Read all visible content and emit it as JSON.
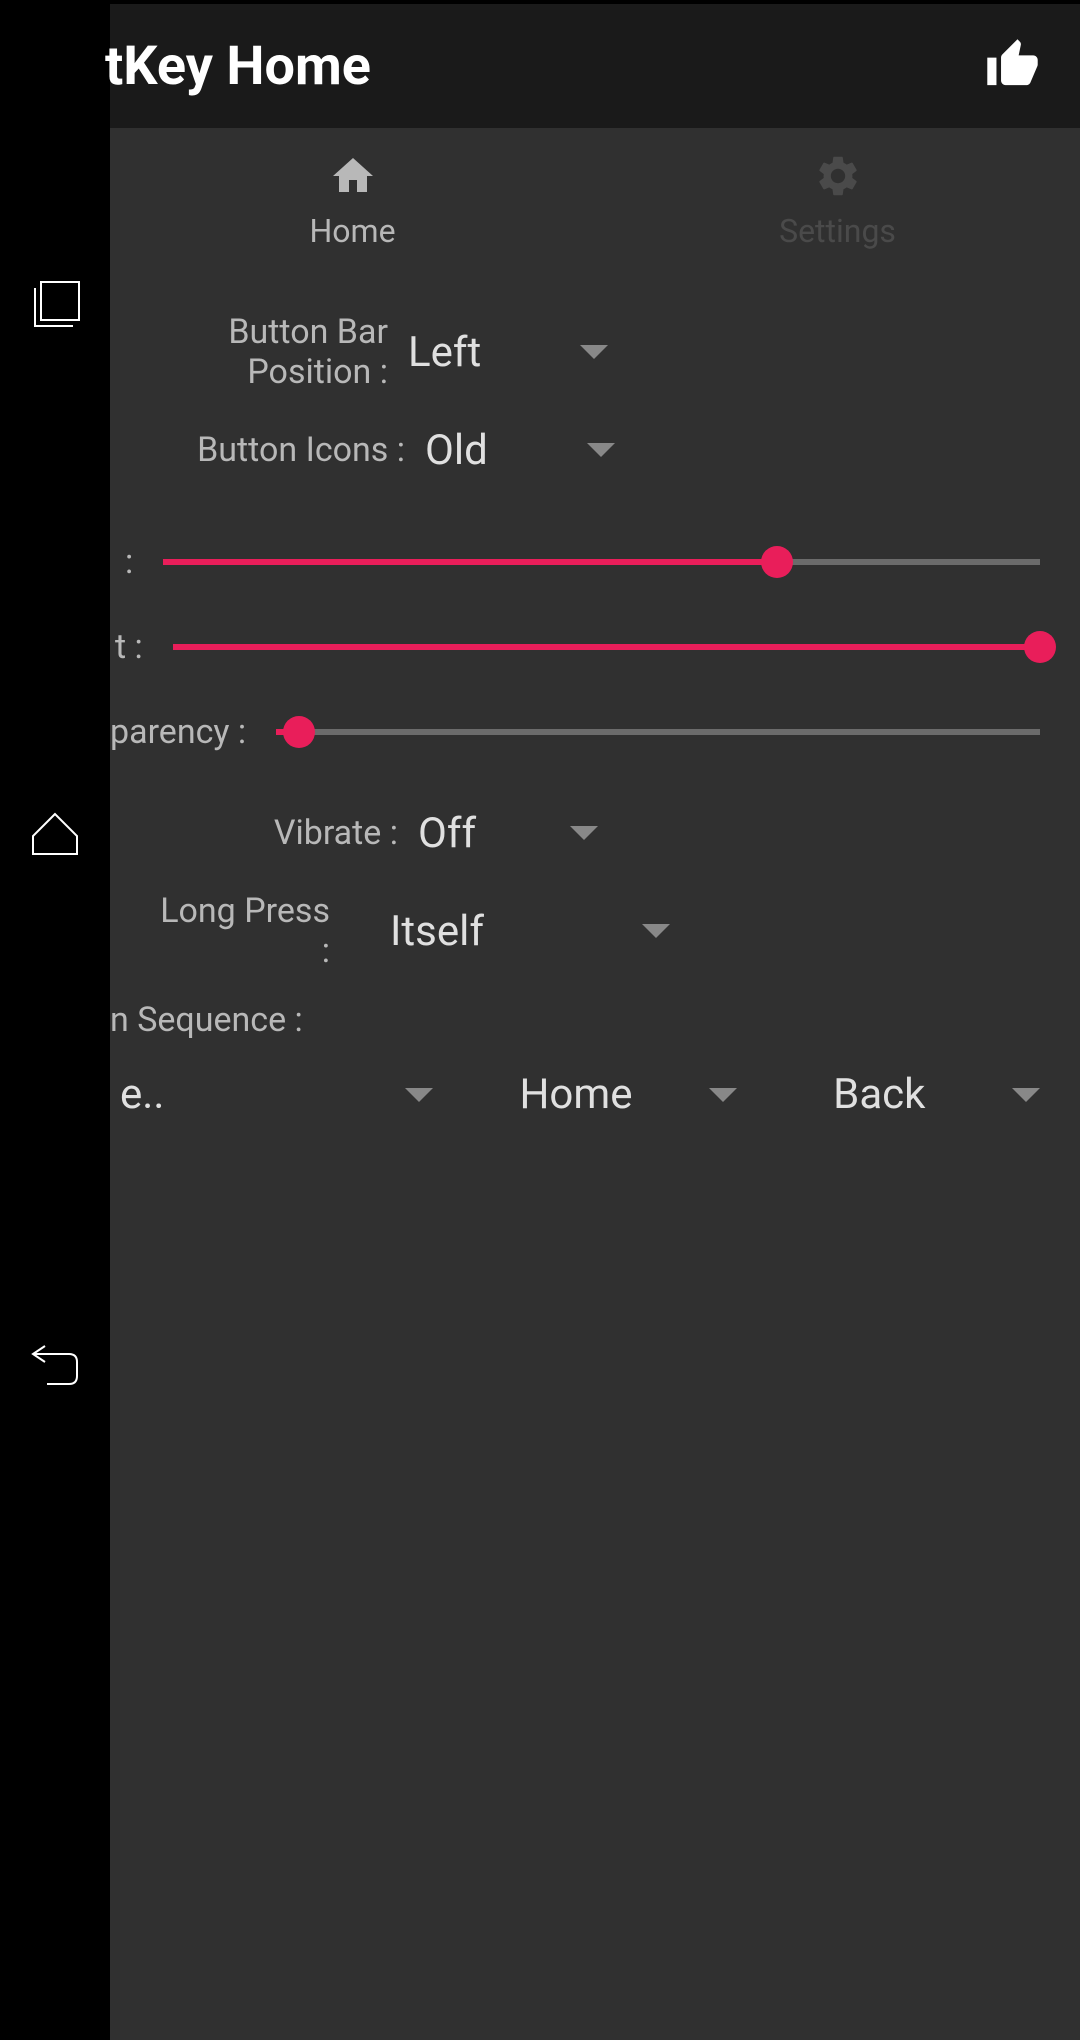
{
  "header": {
    "title": "tKey Home"
  },
  "tabs": {
    "home": "Home",
    "settings": "Settings"
  },
  "settings": {
    "position": {
      "label": "Button Bar Position :",
      "value": "Left"
    },
    "icons": {
      "label": "Button Icons :",
      "value": "Old"
    },
    "slider1": {
      "label": ":",
      "percent": 70
    },
    "slider2": {
      "label": "t :",
      "percent": 100
    },
    "slider3": {
      "label": "parency :",
      "percent": 3
    },
    "vibrate": {
      "label": "Vibrate :",
      "value": "Off"
    },
    "longpress": {
      "label": "Long Press :",
      "value": "Itself"
    },
    "sequence": {
      "label": "n Sequence :",
      "items": [
        "e..",
        "Home",
        "Back"
      ]
    }
  }
}
